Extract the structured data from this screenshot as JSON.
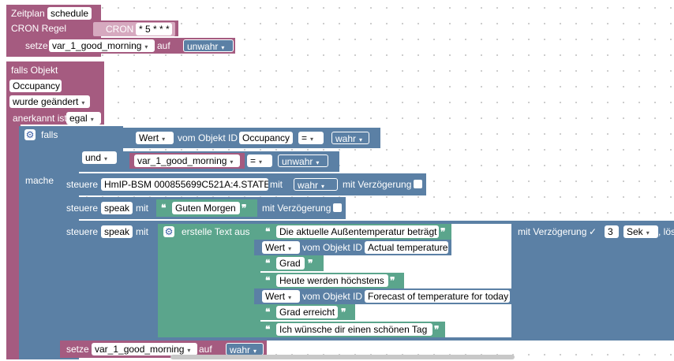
{
  "schedule": {
    "label": "Zeitplan",
    "name": "schedule",
    "cron_label": "CRON Regel",
    "cron_tag": "CRON",
    "cron_value": "* 5 * * *",
    "set_label": "setze",
    "var": "var_1_good_morning",
    "to_label": "auf",
    "value": "unwahr"
  },
  "trigger": {
    "label": "falls Objekt",
    "object": "Occupancy",
    "changed": "wurde geändert",
    "ack_label": "anerkannt ist",
    "ack_value": "egal"
  },
  "if_block": {
    "if_label": "falls",
    "do_label": "mache",
    "and_label": "und",
    "wert": "Wert",
    "of_object": "vom Objekt ID",
    "object": "Occupancy",
    "eq": "=",
    "true_value": "wahr",
    "var": "var_1_good_morning",
    "false_value": "unwahr"
  },
  "control1": {
    "label": "steuere",
    "target": "HmIP-BSM 000855699C521A:4.STATE",
    "with": "mit",
    "value": "wahr",
    "delay": "mit Verzögerung"
  },
  "control2": {
    "label": "steuere",
    "target": "speak",
    "with": "mit",
    "text": "Guten Morgen",
    "delay": "mit Verzögerung"
  },
  "control3": {
    "label": "steuere",
    "target": "speak",
    "with": "mit",
    "build_label": "erstelle Text aus",
    "parts": {
      "t1": "Die aktuelle Außentemperatur beträgt",
      "wert1": "Wert",
      "obj1_label": "vom Objekt ID",
      "obj1": "Actual temperature",
      "t2": "Grad",
      "t3": "Heute werden höchstens",
      "wert2": "Wert",
      "obj2_label": "vom Objekt ID",
      "obj2": "Forecast of temperature for today",
      "t4": "Grad erreicht",
      "t5": "Ich wünsche dir einen schönen Tag"
    },
    "delay": "mit Verzögerung",
    "delay_value": "3",
    "unit": "Sek",
    "clear": ", lösc"
  },
  "final_set": {
    "label": "setze",
    "var": "var_1_good_morning",
    "to_label": "auf",
    "value": "wahr"
  },
  "glyphs": {
    "open_quote": "❝",
    "close_quote": "❞",
    "arrow": "▾",
    "check": "✓",
    "gear": "⚙"
  },
  "colors": {
    "event": "#a55b80",
    "event_light": "#d6a9bf",
    "logic": "#5b80a5",
    "text": "#5ba58c",
    "variable": "#a55b80"
  }
}
